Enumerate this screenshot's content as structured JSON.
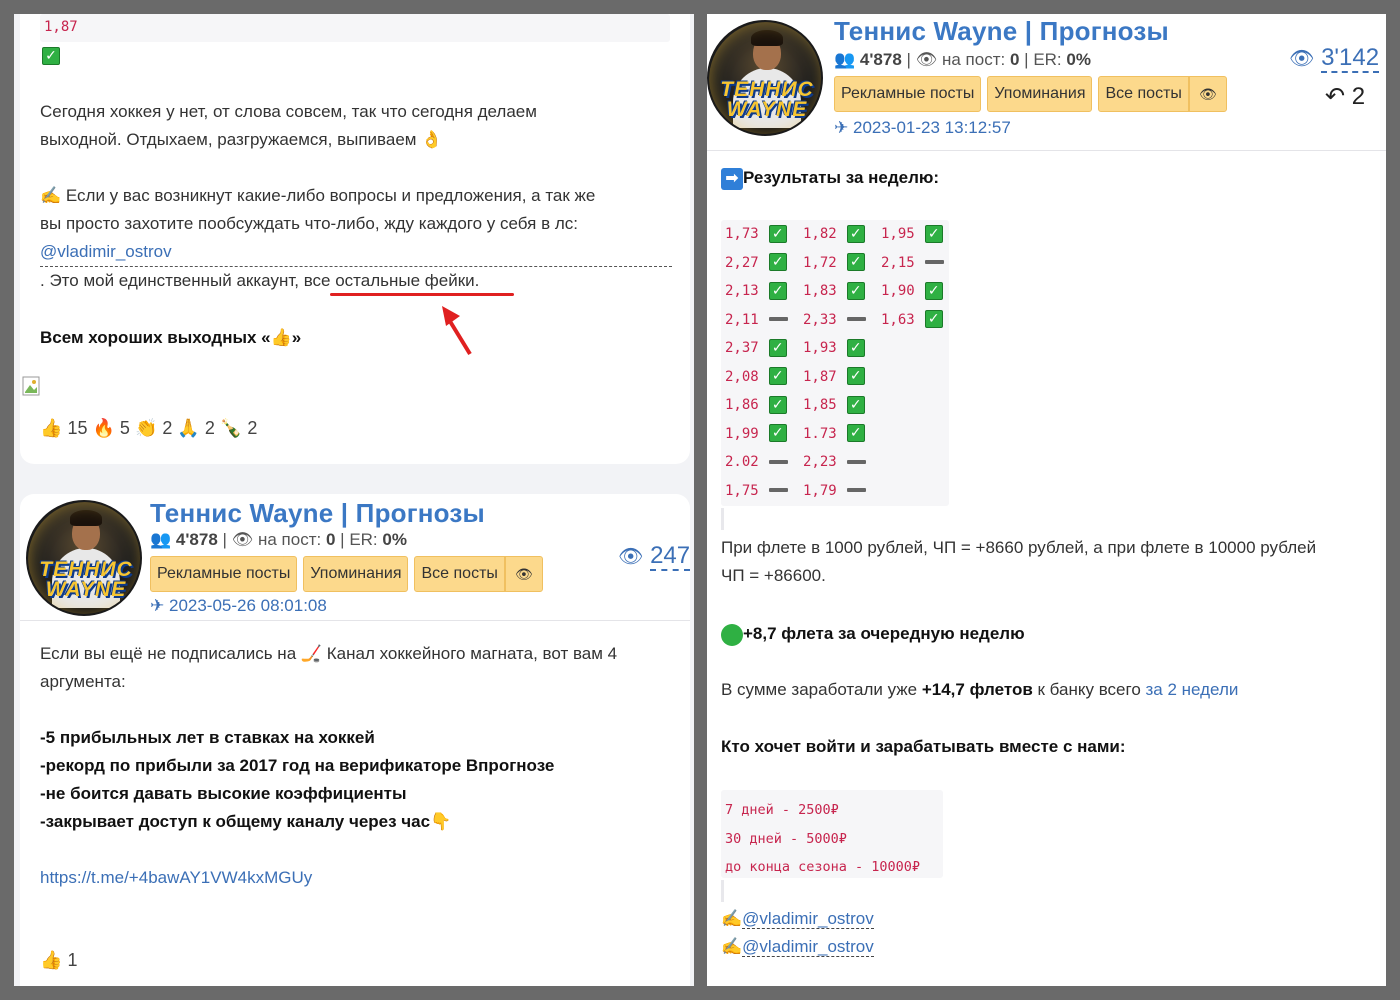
{
  "post1": {
    "code_value": "1,87",
    "text1": "Сегодня хоккея у нет, от слова совсем, так что сегодня делаем",
    "text2": "выходной. Отдыхаем, разгружаемся, выпиваем 👌",
    "text3": "✍️ Если у вас возникнут какие-либо вопросы и предложения, а так же",
    "text4": "вы просто захотите пообсуждать что-либо, жду каждого у себя в лс:",
    "mention": "@vladimir_ostrov",
    "text5_a": ". Это мой единственный аккаунт, ",
    "text5_b": "все остальные фейки",
    "text5_c": ".",
    "text6": "Всем хороших выходных «👍»",
    "reactions": [
      {
        "icon": "👍",
        "count": "15"
      },
      {
        "icon": "🔥",
        "count": "5"
      },
      {
        "icon": "👏",
        "count": "2"
      },
      {
        "icon": "🙏",
        "count": "2"
      },
      {
        "icon": "🍾",
        "count": "2"
      }
    ]
  },
  "post2": {
    "channel": "Теннис Wayne | Прогнозы",
    "subscribers": "4'878",
    "per_post_label": "на пост:",
    "per_post": "0",
    "er_label": "ER:",
    "er": "0%",
    "buttons": [
      "Рекламные посты",
      "Упоминания",
      "Все посты"
    ],
    "date": "2023-05-26 08:01:08",
    "views": "247",
    "text1": "Если вы ещё не подписались на 🏒 Канал хоккейного магната, вот вам 4",
    "text2": "аргумента:",
    "bullets": [
      "-5 прибыльных лет в ставках на хоккей",
      "-рекорд по прибыли за 2017 год на верификаторе Впрогнозе",
      "-не боится давать высокие коэффициенты",
      "-закрывает доступ к общему каналу через час👇"
    ],
    "link": "https://t.me/+4bawAY1VW4kxMGUy",
    "reactions": [
      {
        "icon": "👍",
        "count": "1"
      }
    ]
  },
  "post3": {
    "channel": "Теннис Wayne | Прогнозы",
    "subscribers": "4'878",
    "per_post_label": "на пост:",
    "per_post": "0",
    "er_label": "ER:",
    "er": "0%",
    "buttons": [
      "Рекламные посты",
      "Упоминания",
      "Все посты"
    ],
    "date": "2023-01-23 13:12:57",
    "views": "3'142",
    "reposts": "2",
    "results_title": "Результаты за неделю:",
    "results": [
      [
        [
          "1,73",
          "win"
        ],
        [
          "1,82",
          "win"
        ],
        [
          "1,95",
          "win"
        ]
      ],
      [
        [
          "2,27",
          "win"
        ],
        [
          "1,72",
          "win"
        ],
        [
          "2,15",
          "void"
        ]
      ],
      [
        [
          "2,13",
          "win"
        ],
        [
          "1,83",
          "win"
        ],
        [
          "1,90",
          "win"
        ]
      ],
      [
        [
          "2,11",
          "void"
        ],
        [
          "2,33",
          "void"
        ],
        [
          "1,63",
          "win"
        ]
      ],
      [
        [
          "2,37",
          "win"
        ],
        [
          "1,93",
          "win"
        ]
      ],
      [
        [
          "2,08",
          "win"
        ],
        [
          "1,87",
          "win"
        ]
      ],
      [
        [
          "1,86",
          "win"
        ],
        [
          "1,85",
          "win"
        ]
      ],
      [
        [
          "1,99",
          "win"
        ],
        [
          "1.73",
          "win"
        ]
      ],
      [
        [
          "2.02",
          "void"
        ],
        [
          "2,23",
          "void"
        ]
      ],
      [
        [
          "1,75",
          "void"
        ],
        [
          "1,79",
          "void"
        ]
      ]
    ],
    "flat_text1": "При флете в 1000 рублей, ЧП = +8660 рублей, а при флете в 10000 рублей",
    "flat_text2": "ЧП = +86600.",
    "week_result": "+8,7 флета за очередную неделю",
    "sum_a": "В сумме заработали уже ",
    "sum_b": "+14,7 флетов",
    "sum_c": " к банку всего ",
    "sum_link": "за 2 недели",
    "join_title": "Кто хочет войти и зарабатывать вместе с нами:",
    "prices": [
      "7 дней - 2500₽",
      "30 дней - 5000₽",
      "до конца сезона - 10000₽"
    ],
    "contacts": [
      "@vladimir_ostrov",
      "@vladimir_ostrov"
    ]
  },
  "colors": {
    "accent": "#3b78c4",
    "button": "#fcd98c",
    "check": "#2fb043",
    "code": "#c7254e"
  }
}
